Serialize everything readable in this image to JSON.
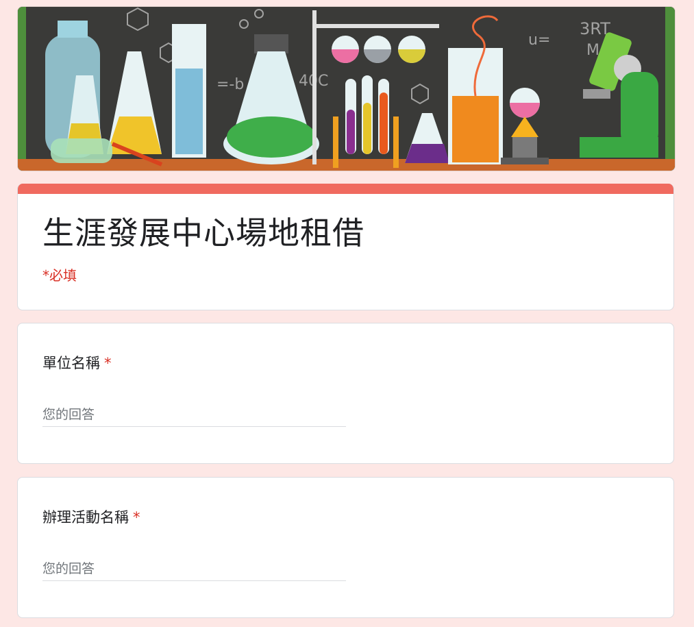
{
  "header": {
    "banner_image": "chemistry-lab-illustration",
    "accent_color": "#f06a5f"
  },
  "form": {
    "title": "生涯發展中心場地租借",
    "required_note": "*必填"
  },
  "questions": [
    {
      "label": "單位名稱",
      "required_mark": "*",
      "placeholder": "您的回答"
    },
    {
      "label": "辦理活動名稱",
      "required_mark": "*",
      "placeholder": "您的回答"
    }
  ],
  "colors": {
    "page_background": "#fde7e5",
    "required": "#d93025"
  }
}
